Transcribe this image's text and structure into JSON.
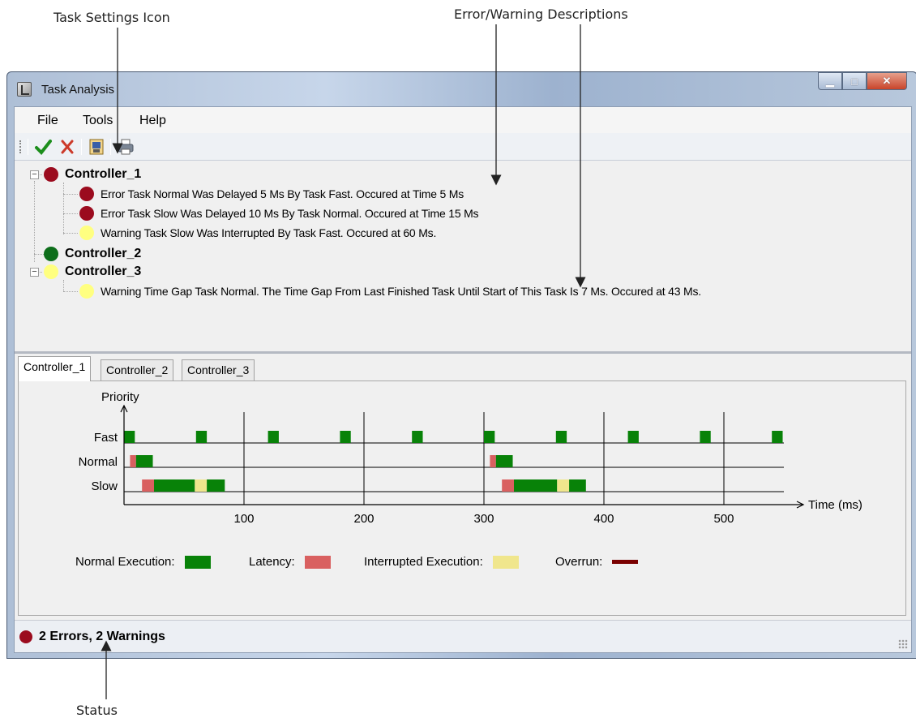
{
  "callouts": {
    "task_settings_icon": "Task Settings Icon",
    "error_warning_descriptions": "Error/Warning Descriptions",
    "status": "Status"
  },
  "window": {
    "title": "Task Analysis",
    "buttons": [
      "minimize",
      "maximize",
      "close"
    ]
  },
  "menu": [
    "File",
    "Tools",
    "Help"
  ],
  "toolbar": {
    "icons": [
      "check-icon",
      "delete-icon",
      "task-settings-icon",
      "print-icon"
    ]
  },
  "colors": {
    "error": "#9b0b1e",
    "ok": "#0d6e1b",
    "warning": "#ffff80",
    "normal_execution": "#088208",
    "latency": "#d96060",
    "interrupted": "#f0e68c",
    "overrun": "#7a0000"
  },
  "tree": [
    {
      "name": "Controller_1",
      "status": "error",
      "expanded": true,
      "messages": [
        {
          "status": "error",
          "text": "Error Task Normal Was Delayed 5 Ms By Task Fast. Occured at Time 5 Ms"
        },
        {
          "status": "error",
          "text": "Error Task Slow Was Delayed 10 Ms By Task Normal. Occured at Time 15 Ms"
        },
        {
          "status": "warning",
          "text": "Warning Task Slow Was Interrupted By Task Fast. Occured at 60 Ms."
        }
      ]
    },
    {
      "name": "Controller_2",
      "status": "ok",
      "expanded": false,
      "messages": []
    },
    {
      "name": "Controller_3",
      "status": "warning",
      "expanded": true,
      "messages": [
        {
          "status": "warning",
          "text": "Warning Time Gap Task Normal. The Time Gap From Last Finished Task Until Start of This Task Is 7 Ms. Occured at 43 Ms."
        }
      ]
    }
  ],
  "tabs": [
    "Controller_1",
    "Controller_2",
    "Controller_3"
  ],
  "active_tab": "Controller_1",
  "chart_data": {
    "type": "timeline",
    "ylabel": "Priority",
    "xlabel": "Time (ms)",
    "x_ticks": [
      100,
      200,
      300,
      400,
      500
    ],
    "x_range": [
      0,
      550
    ],
    "vertical_gridlines": [
      100,
      200,
      300,
      400,
      500
    ],
    "rows": [
      "Fast",
      "Normal",
      "Slow"
    ],
    "segments": [
      {
        "row": "Fast",
        "kind": "normal",
        "start": 0,
        "end": 9
      },
      {
        "row": "Fast",
        "kind": "normal",
        "start": 60,
        "end": 69
      },
      {
        "row": "Fast",
        "kind": "normal",
        "start": 120,
        "end": 129
      },
      {
        "row": "Fast",
        "kind": "normal",
        "start": 180,
        "end": 189
      },
      {
        "row": "Fast",
        "kind": "normal",
        "start": 240,
        "end": 249
      },
      {
        "row": "Fast",
        "kind": "normal",
        "start": 300,
        "end": 309
      },
      {
        "row": "Fast",
        "kind": "normal",
        "start": 360,
        "end": 369
      },
      {
        "row": "Fast",
        "kind": "normal",
        "start": 420,
        "end": 429
      },
      {
        "row": "Fast",
        "kind": "normal",
        "start": 480,
        "end": 489
      },
      {
        "row": "Fast",
        "kind": "normal",
        "start": 540,
        "end": 549
      },
      {
        "row": "Normal",
        "kind": "latency",
        "start": 5,
        "end": 10
      },
      {
        "row": "Normal",
        "kind": "normal",
        "start": 10,
        "end": 24
      },
      {
        "row": "Normal",
        "kind": "latency",
        "start": 305,
        "end": 310
      },
      {
        "row": "Normal",
        "kind": "normal",
        "start": 310,
        "end": 324
      },
      {
        "row": "Slow",
        "kind": "latency",
        "start": 15,
        "end": 25
      },
      {
        "row": "Slow",
        "kind": "normal",
        "start": 25,
        "end": 59
      },
      {
        "row": "Slow",
        "kind": "interrupted",
        "start": 59,
        "end": 69
      },
      {
        "row": "Slow",
        "kind": "normal",
        "start": 69,
        "end": 84
      },
      {
        "row": "Slow",
        "kind": "latency",
        "start": 315,
        "end": 325
      },
      {
        "row": "Slow",
        "kind": "normal",
        "start": 325,
        "end": 361
      },
      {
        "row": "Slow",
        "kind": "interrupted",
        "start": 361,
        "end": 371
      },
      {
        "row": "Slow",
        "kind": "normal",
        "start": 371,
        "end": 385
      }
    ],
    "legend": [
      {
        "label": "Normal Execution:",
        "kind": "normal"
      },
      {
        "label": "Latency:",
        "kind": "latency"
      },
      {
        "label": "Interrupted Execution:",
        "kind": "interrupted"
      },
      {
        "label": "Overrun:",
        "kind": "overrun"
      }
    ]
  },
  "status": {
    "icon": "error",
    "text": "2 Errors, 2 Warnings"
  }
}
